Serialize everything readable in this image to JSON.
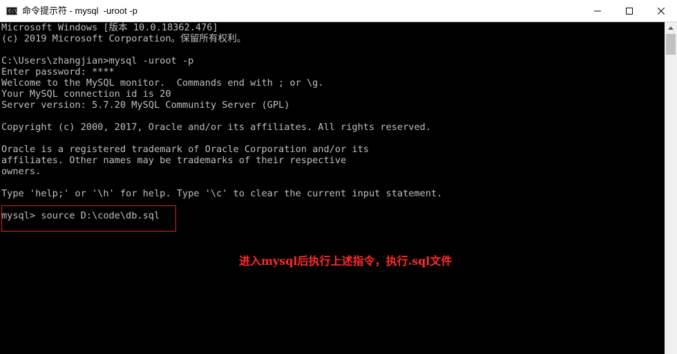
{
  "window": {
    "icon_label": "C:\\",
    "title": "命令提示符 - mysql  -uroot -p",
    "buttons": {
      "minimize": "minimize-icon",
      "maximize": "maximize-icon",
      "close": "close-icon"
    }
  },
  "console": {
    "lines": [
      "Microsoft Windows [版本 10.0.18362.476]",
      "(c) 2019 Microsoft Corporation。保留所有权利。",
      "",
      "C:\\Users\\zhangjian>mysql -uroot -p",
      "Enter password: ****",
      "Welcome to the MySQL monitor.  Commands end with ; or \\g.",
      "Your MySQL connection id is 20",
      "Server version: 5.7.20 MySQL Community Server (GPL)",
      "",
      "Copyright (c) 2000, 2017, Oracle and/or its affiliates. All rights reserved.",
      "",
      "Oracle is a registered trademark of Oracle Corporation and/or its",
      "affiliates. Other names may be trademarks of their respective",
      "owners.",
      "",
      "Type 'help;' or '\\h' for help. Type '\\c' to clear the current input statement.",
      "",
      "mysql> source D:\\code\\db.sql"
    ]
  },
  "annotation": {
    "text": "进入mysql后执行上述指令，执行.sql文件"
  },
  "colors": {
    "console_bg": "#000000",
    "console_text": "#c0c0c0",
    "annotation": "#ff2a2a",
    "highlight_border": "#e02020"
  }
}
